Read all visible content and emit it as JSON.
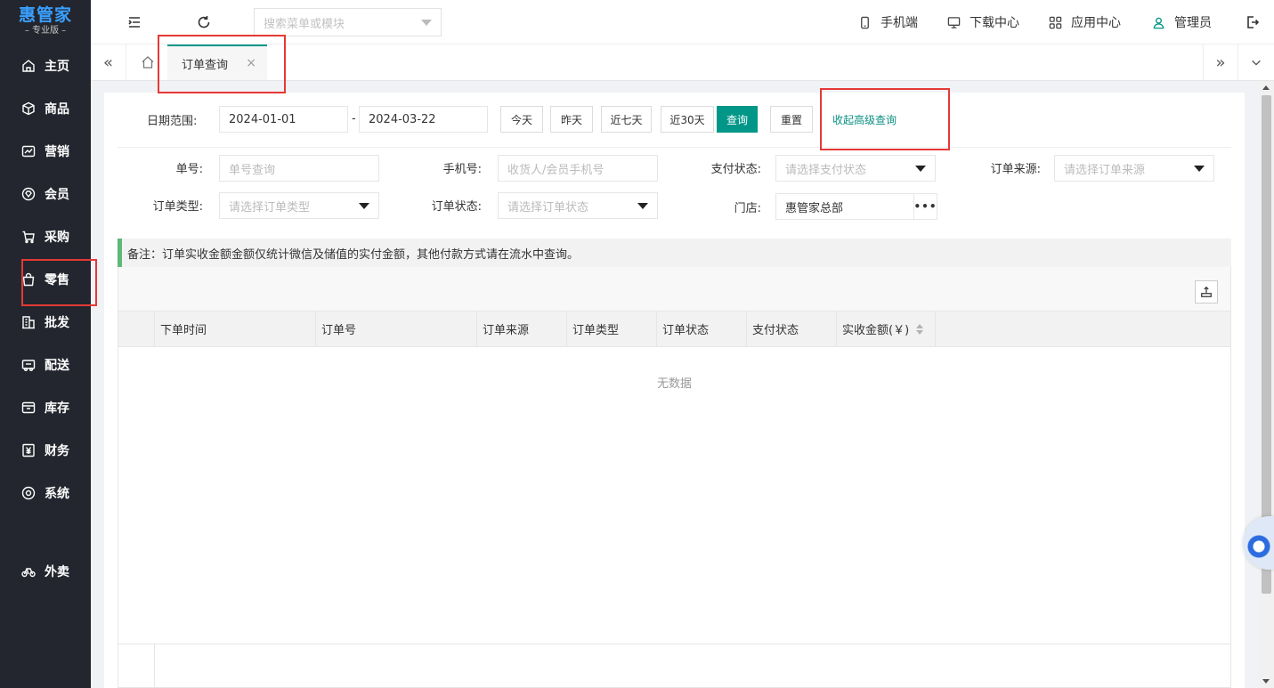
{
  "brand": {
    "name": "惠管家",
    "edition": "– 专业版 –"
  },
  "sidebar": {
    "items": [
      {
        "label": "主页",
        "icon": "home-icon"
      },
      {
        "label": "商品",
        "icon": "box-icon"
      },
      {
        "label": "营销",
        "icon": "chart-icon"
      },
      {
        "label": "会员",
        "icon": "diamond-icon"
      },
      {
        "label": "采购",
        "icon": "cart-icon"
      },
      {
        "label": "零售",
        "icon": "shopping-bag-icon"
      },
      {
        "label": "批发",
        "icon": "building-icon"
      },
      {
        "label": "配送",
        "icon": "delivery-icon"
      },
      {
        "label": "库存",
        "icon": "archive-icon"
      },
      {
        "label": "财务",
        "icon": "yen-icon"
      },
      {
        "label": "系统",
        "icon": "settings-icon"
      },
      {
        "label": "外卖",
        "icon": "bike-icon"
      }
    ]
  },
  "header": {
    "search_placeholder": "搜索菜单或模块",
    "mobile": "手机端",
    "download": "下载中心",
    "apps": "应用中心",
    "user": "管理员"
  },
  "tabs": {
    "active": "订单查询",
    "close": "×"
  },
  "filters": {
    "date_label": "日期范围:",
    "date_start": "2024-01-01",
    "date_sep": "-",
    "date_end": "2024-03-22",
    "btn_today": "今天",
    "btn_yesterday": "昨天",
    "btn_7days": "近七天",
    "btn_30days": "近30天",
    "btn_query": "查询",
    "btn_reset": "重置",
    "toggle_advanced": "收起高级查询",
    "order_no_label": "单号:",
    "order_no_placeholder": "单号查询",
    "phone_label": "手机号:",
    "phone_placeholder": "收货人/会员手机号",
    "pay_status_label": "支付状态:",
    "pay_status_placeholder": "请选择支付状态",
    "source_label": "订单来源:",
    "source_placeholder": "请选择订单来源",
    "type_label": "订单类型:",
    "type_placeholder": "请选择订单类型",
    "status_label": "订单状态:",
    "status_placeholder": "请选择订单状态",
    "store_label": "门店:",
    "store_value": "惠管家总部",
    "store_more": "•••"
  },
  "note": "备注：订单实收金额金额仅统计微信及储值的实付金额，其他付款方式请在流水中查询。",
  "table": {
    "columns": [
      "下单时间",
      "订单号",
      "订单来源",
      "订单类型",
      "订单状态",
      "支付状态",
      "实收金额(￥)"
    ],
    "empty": "无数据"
  },
  "colors": {
    "accent": "#009688",
    "sidebar": "#23262e",
    "brand": "#3aa0ff",
    "highlight": "#e53935"
  }
}
